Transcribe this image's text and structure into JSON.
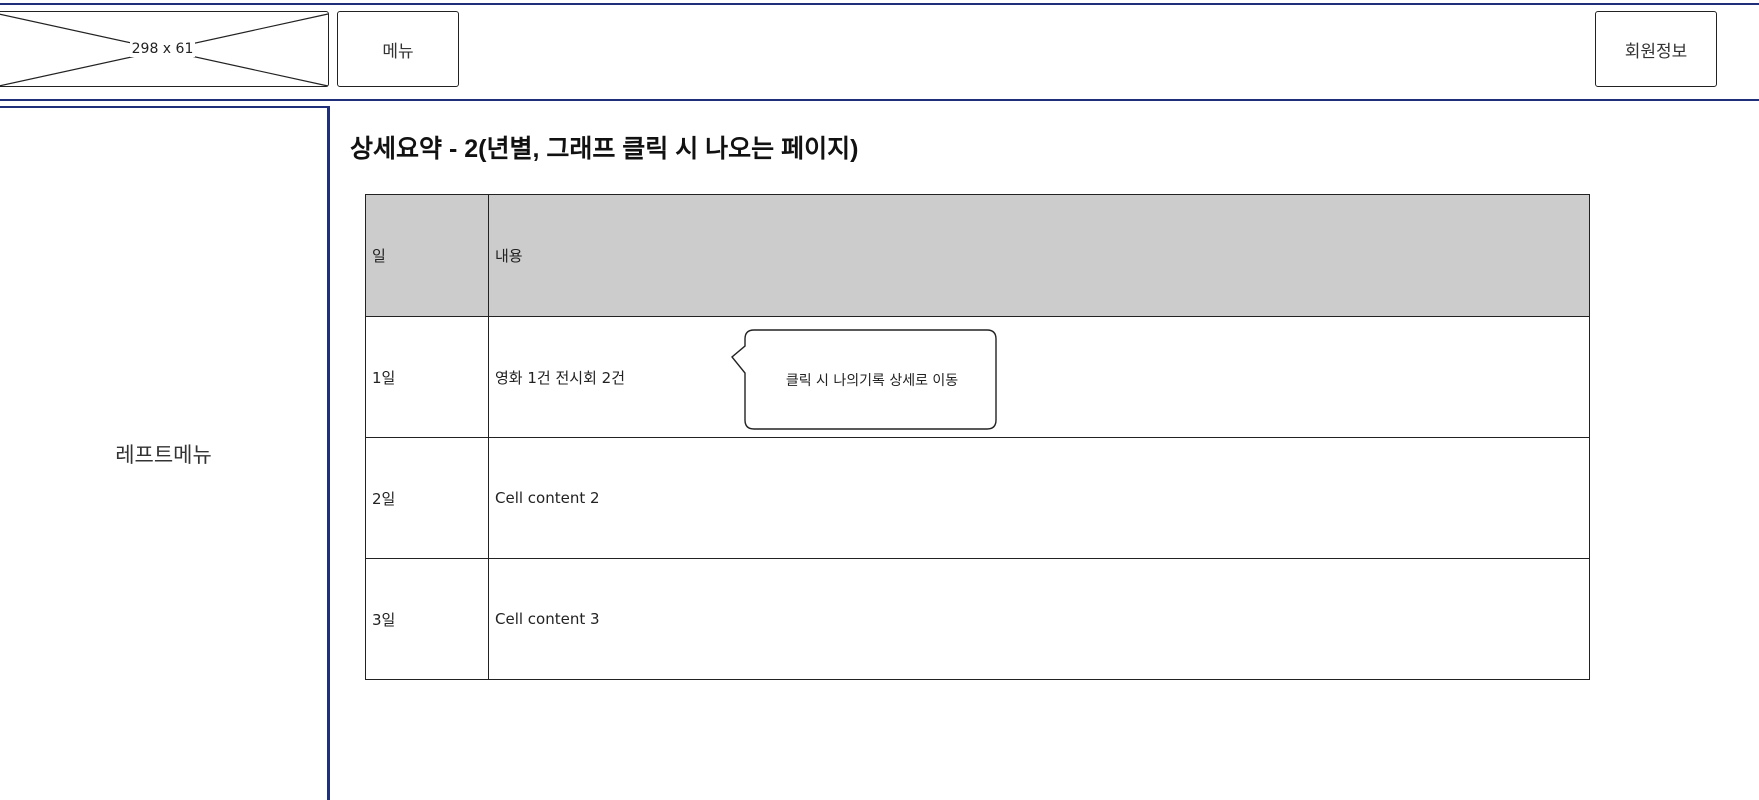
{
  "header": {
    "logo_placeholder": "298 x 61",
    "menu_label": "메뉴",
    "member_info_label": "회원정보"
  },
  "sidebar": {
    "label": "레프트메뉴"
  },
  "main": {
    "title": "상세요약 - 2(년별, 그래프 클릭 시 나오는 페이지)",
    "table": {
      "columns": [
        "일",
        "내용"
      ],
      "rows": [
        {
          "day": "1일",
          "content": "영화 1건 전시회 2건"
        },
        {
          "day": "2일",
          "content": "Cell content 2"
        },
        {
          "day": "3일",
          "content": "Cell content 3"
        }
      ]
    },
    "callout": {
      "text": "클릭 시 나의기록 상세로 이동"
    }
  },
  "colors": {
    "frame_line": "#1f2f7a",
    "header_row_bg": "#cccccc"
  }
}
